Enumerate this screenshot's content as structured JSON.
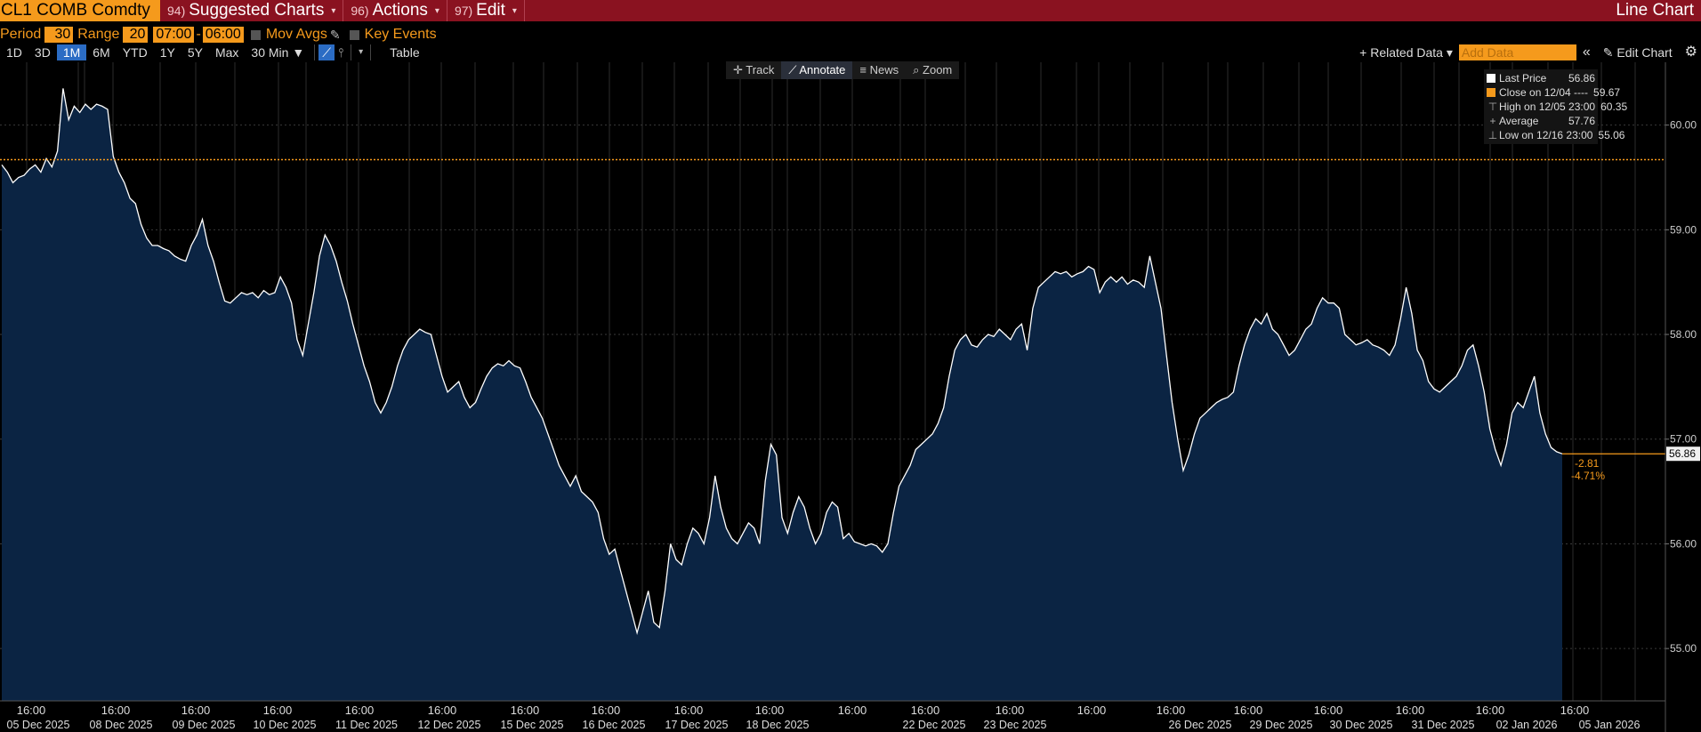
{
  "header": {
    "ticker": "CL1 COMB Comdty",
    "menus": [
      {
        "num": "94)",
        "label": "Suggested Charts"
      },
      {
        "num": "96)",
        "label": "Actions"
      },
      {
        "num": "97)",
        "label": "Edit"
      }
    ],
    "window_title": "Line Chart"
  },
  "settings": {
    "period_label": "Period",
    "period_value": "30",
    "range_label": "Range",
    "range_value": "20",
    "time_start": "07:00",
    "time_end": "06:00",
    "mov_avgs": "Mov Avgs",
    "key_events": "Key Events"
  },
  "toolbar": {
    "ranges": [
      "1D",
      "3D",
      "1M",
      "6M",
      "YTD",
      "1Y",
      "5Y",
      "Max"
    ],
    "active_range": "1M",
    "interval": "30 Min ▼",
    "table": "Table",
    "related_data": "+ Related Data ▾",
    "add_data_placeholder": "Add Data",
    "collapse": "«",
    "edit_chart": "✎ Edit Chart",
    "settings_icon": "⚙"
  },
  "modes": [
    {
      "icon": "✛",
      "label": "Track"
    },
    {
      "icon": "⟋",
      "label": "Annotate"
    },
    {
      "icon": "≡",
      "label": "News"
    },
    {
      "icon": "⌕",
      "label": "Zoom"
    }
  ],
  "legend": [
    {
      "label": "Last Price",
      "value": "56.86",
      "color": "#ffffff"
    },
    {
      "label": "Close on 12/04 ----",
      "value": "59.67",
      "color": "#f59a1c"
    },
    {
      "label": "High on 12/05 23:00",
      "value": "60.35",
      "marker": "⊤"
    },
    {
      "label": "Average",
      "value": "57.76",
      "marker": "+"
    },
    {
      "label": "Low on 12/16 23:00",
      "value": "55.06",
      "marker": "⊥"
    }
  ],
  "colors": {
    "title_bar": "#8a1220",
    "accent_orange": "#f59a1c",
    "area_fill": "#0b2443",
    "line": "#ffffff",
    "active_blue": "#2b6cc4"
  },
  "chart_data": {
    "type": "area",
    "y_range": [
      54.5,
      60.6
    ],
    "y_ticks": [
      "55.00",
      "56.00",
      "57.00",
      "58.00",
      "59.00",
      "60.00"
    ],
    "close_reference": 59.67,
    "last_price_label": "56.86",
    "change": "-2.81",
    "change_pct": "-4.71%",
    "x_time_labels": [
      "16:00",
      "16:00",
      "16:00",
      "16:00",
      "16:00",
      "16:00",
      "16:00",
      "16:00",
      "16:00",
      "16:00",
      "16:00",
      "16:00",
      "16:00",
      "16:00",
      "16:00",
      "16:00",
      "16:00",
      "16:00",
      "16:00",
      "16:00"
    ],
    "x_date_labels": [
      "05 Dec 2025",
      "08 Dec 2025",
      "09 Dec 2025",
      "10 Dec 2025",
      "11 Dec 2025",
      "12 Dec 2025",
      "15 Dec 2025",
      "16 Dec 2025",
      "17 Dec 2025",
      "18 Dec 2025",
      "22 Dec 2025",
      "23 Dec 2025",
      "26 Dec 2025",
      "29 Dec 2025",
      "30 Dec 2025",
      "31 Dec 2025",
      "02 Jan 2026",
      "05 Jan 2026"
    ],
    "series": [
      {
        "values": [
          59.62,
          59.55,
          59.45,
          59.5,
          59.52,
          59.58,
          59.62,
          59.55,
          59.68,
          59.6,
          59.75,
          60.35,
          60.05,
          60.18,
          60.12,
          60.2,
          60.15,
          60.2,
          60.18,
          60.15,
          59.7,
          59.55,
          59.45,
          59.3,
          59.25,
          59.05,
          58.92,
          58.85,
          58.85,
          58.82,
          58.8,
          58.75,
          58.72,
          58.7,
          58.85,
          58.95,
          59.1,
          58.85,
          58.7,
          58.5,
          58.32,
          58.3,
          58.35,
          58.4,
          58.38,
          58.4,
          58.35,
          58.42,
          58.38,
          58.4,
          58.55,
          58.45,
          58.3,
          57.95,
          57.8,
          58.1,
          58.4,
          58.75,
          58.95,
          58.85,
          58.7,
          58.5,
          58.32,
          58.1,
          57.9,
          57.7,
          57.55,
          57.35,
          57.25,
          57.35,
          57.5,
          57.7,
          57.85,
          57.95,
          58.0,
          58.05,
          58.02,
          58.0,
          57.8,
          57.6,
          57.45,
          57.5,
          57.55,
          57.4,
          57.3,
          57.35,
          57.48,
          57.6,
          57.68,
          57.72,
          57.7,
          57.75,
          57.7,
          57.68,
          57.55,
          57.4,
          57.3,
          57.2,
          57.05,
          56.9,
          56.75,
          56.65,
          56.55,
          56.65,
          56.5,
          56.45,
          56.4,
          56.3,
          56.05,
          55.9,
          55.95,
          55.75,
          55.55,
          55.35,
          55.15,
          55.35,
          55.55,
          55.25,
          55.2,
          55.55,
          56.0,
          55.85,
          55.8,
          56.0,
          56.15,
          56.1,
          56.0,
          56.25,
          56.65,
          56.35,
          56.15,
          56.05,
          56.0,
          56.1,
          56.2,
          56.15,
          56.0,
          56.6,
          56.95,
          56.85,
          56.25,
          56.1,
          56.3,
          56.45,
          56.35,
          56.15,
          56.0,
          56.1,
          56.3,
          56.4,
          56.35,
          56.05,
          56.1,
          56.02,
          56.0,
          55.98,
          56.0,
          55.98,
          55.92,
          56.0,
          56.3,
          56.55,
          56.65,
          56.75,
          56.9,
          56.95,
          57.0,
          57.05,
          57.15,
          57.3,
          57.6,
          57.85,
          57.95,
          58.0,
          57.9,
          57.88,
          57.95,
          58.0,
          57.98,
          58.05,
          58.0,
          57.95,
          58.05,
          58.1,
          57.85,
          58.25,
          58.45,
          58.5,
          58.55,
          58.6,
          58.58,
          58.6,
          58.55,
          58.58,
          58.6,
          58.65,
          58.62,
          58.4,
          58.5,
          58.55,
          58.5,
          58.55,
          58.48,
          58.52,
          58.5,
          58.45,
          58.75,
          58.5,
          58.25,
          57.8,
          57.35,
          57.0,
          56.7,
          56.85,
          57.05,
          57.2,
          57.25,
          57.3,
          57.35,
          57.38,
          57.4,
          57.45,
          57.7,
          57.9,
          58.05,
          58.15,
          58.1,
          58.2,
          58.05,
          58.0,
          57.9,
          57.8,
          57.85,
          57.95,
          58.05,
          58.1,
          58.25,
          58.35,
          58.3,
          58.3,
          58.25,
          58.0,
          57.95,
          57.9,
          57.92,
          57.95,
          57.9,
          57.88,
          57.85,
          57.8,
          57.9,
          58.15,
          58.45,
          58.2,
          57.85,
          57.75,
          57.55,
          57.48,
          57.45,
          57.5,
          57.55,
          57.6,
          57.7,
          57.85,
          57.9,
          57.7,
          57.45,
          57.1,
          56.9,
          56.75,
          56.95,
          57.25,
          57.35,
          57.3,
          57.45,
          57.6,
          57.25,
          57.05,
          56.92,
          56.88,
          56.86
        ]
      }
    ]
  }
}
